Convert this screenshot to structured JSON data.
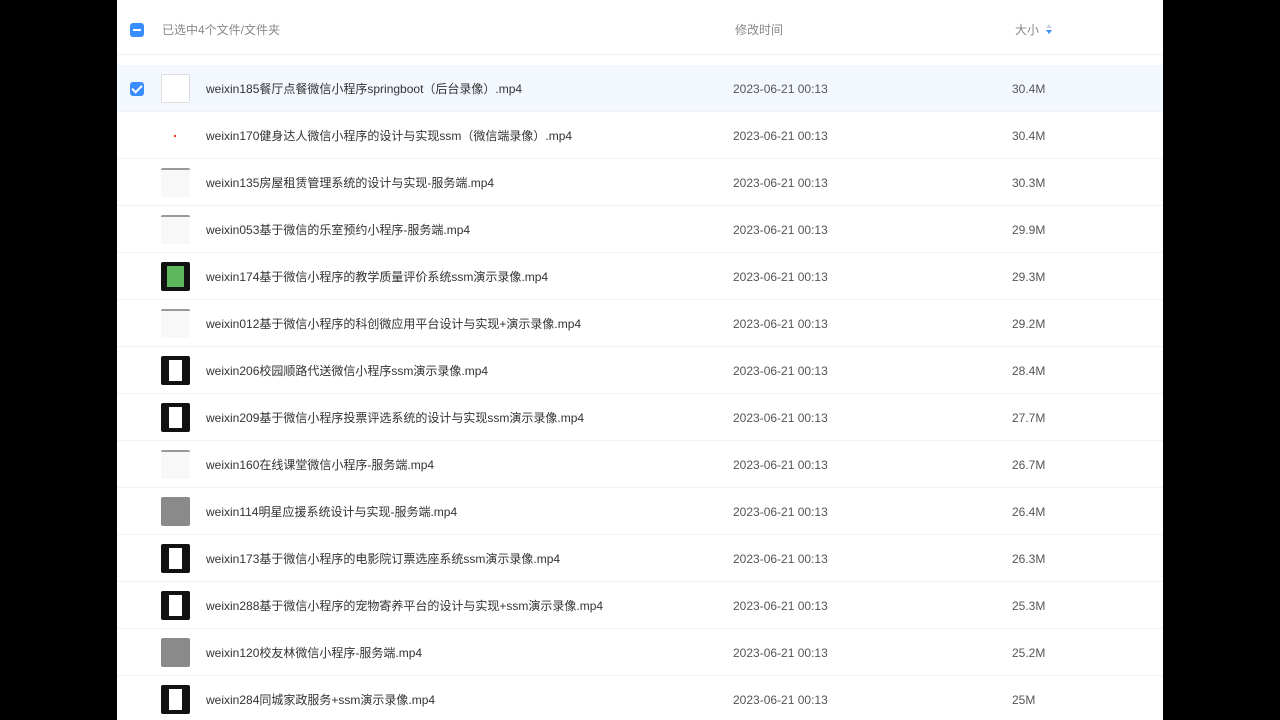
{
  "header": {
    "selection_text": "已选中4个文件/文件夹",
    "modified_label": "修改时间",
    "size_label": "大小"
  },
  "colors": {
    "accent": "#3a8dff",
    "selected_row_bg": "#f3f8ff"
  },
  "files": [
    {
      "name": "weixin185餐厅点餐微信小程序springboot（后台录像）.mp4",
      "modified": "2023-06-21 00:13",
      "size": "30.4M",
      "selected": true,
      "thumb": "light"
    },
    {
      "name": "weixin170健身达人微信小程序的设计与实现ssm（微信端录像）.mp4",
      "modified": "2023-06-21 00:13",
      "size": "30.4M",
      "selected": false,
      "thumb": "dot"
    },
    {
      "name": "weixin135房屋租赁管理系统的设计与实现-服务端.mp4",
      "modified": "2023-06-21 00:13",
      "size": "30.3M",
      "selected": false,
      "thumb": "doc"
    },
    {
      "name": "weixin053基于微信的乐室预约小程序-服务端.mp4",
      "modified": "2023-06-21 00:13",
      "size": "29.9M",
      "selected": false,
      "thumb": "doc"
    },
    {
      "name": "weixin174基于微信小程序的教学质量评价系统ssm演示录像.mp4",
      "modified": "2023-06-21 00:13",
      "size": "29.3M",
      "selected": false,
      "thumb": "green"
    },
    {
      "name": "weixin012基于微信小程序的科创微应用平台设计与实现+演示录像.mp4",
      "modified": "2023-06-21 00:13",
      "size": "29.2M",
      "selected": false,
      "thumb": "doc"
    },
    {
      "name": "weixin206校园顺路代送微信小程序ssm演示录像.mp4",
      "modified": "2023-06-21 00:13",
      "size": "28.4M",
      "selected": false,
      "thumb": "dark"
    },
    {
      "name": "weixin209基于微信小程序投票评选系统的设计与实现ssm演示录像.mp4",
      "modified": "2023-06-21 00:13",
      "size": "27.7M",
      "selected": false,
      "thumb": "dark"
    },
    {
      "name": "weixin160在线课堂微信小程序-服务端.mp4",
      "modified": "2023-06-21 00:13",
      "size": "26.7M",
      "selected": false,
      "thumb": "doc"
    },
    {
      "name": "weixin114明星应援系统设计与实现-服务端.mp4",
      "modified": "2023-06-21 00:13",
      "size": "26.4M",
      "selected": false,
      "thumb": "gray"
    },
    {
      "name": "weixin173基于微信小程序的电影院订票选座系统ssm演示录像.mp4",
      "modified": "2023-06-21 00:13",
      "size": "26.3M",
      "selected": false,
      "thumb": "dark"
    },
    {
      "name": "weixin288基于微信小程序的宠物寄养平台的设计与实现+ssm演示录像.mp4",
      "modified": "2023-06-21 00:13",
      "size": "25.3M",
      "selected": false,
      "thumb": "dark"
    },
    {
      "name": "weixin120校友林微信小程序-服务端.mp4",
      "modified": "2023-06-21 00:13",
      "size": "25.2M",
      "selected": false,
      "thumb": "gray"
    },
    {
      "name": "weixin284同城家政服务+ssm演示录像.mp4",
      "modified": "2023-06-21 00:13",
      "size": "25M",
      "selected": false,
      "thumb": "dark"
    }
  ]
}
